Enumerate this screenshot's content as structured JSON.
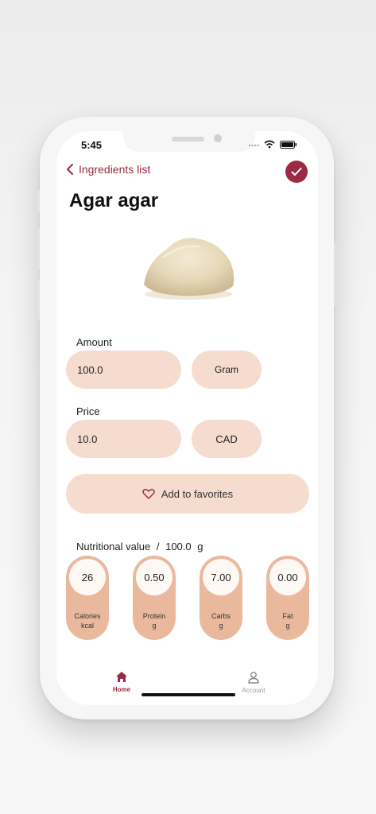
{
  "status_bar": {
    "time": "5:45"
  },
  "nav": {
    "back_label": "Ingredients list"
  },
  "page": {
    "title": "Agar agar"
  },
  "amount": {
    "label": "Amount",
    "value": "100.0",
    "unit": "Gram"
  },
  "price": {
    "label": "Price",
    "value": "10.0",
    "currency": "CAD"
  },
  "favorites": {
    "label": "Add to favorites"
  },
  "nutrition": {
    "label": "Nutritional value",
    "separator": "/",
    "amount": "100.0",
    "unit": "g",
    "items": [
      {
        "value": "26",
        "name": "Calories",
        "unit": "kcal"
      },
      {
        "value": "0.50",
        "name": "Protein",
        "unit": "g"
      },
      {
        "value": "7.00",
        "name": "Carbs",
        "unit": "g"
      },
      {
        "value": "0.00",
        "name": "Fat",
        "unit": "g"
      }
    ]
  },
  "tab_bar": {
    "home": {
      "label": "Home",
      "icon": "home-icon"
    },
    "account": {
      "label": "Account",
      "icon": "person-icon"
    }
  },
  "colors": {
    "accent": "#9a2b43",
    "pill": "#f5dccf",
    "nutrition_card": "#eab99d"
  }
}
